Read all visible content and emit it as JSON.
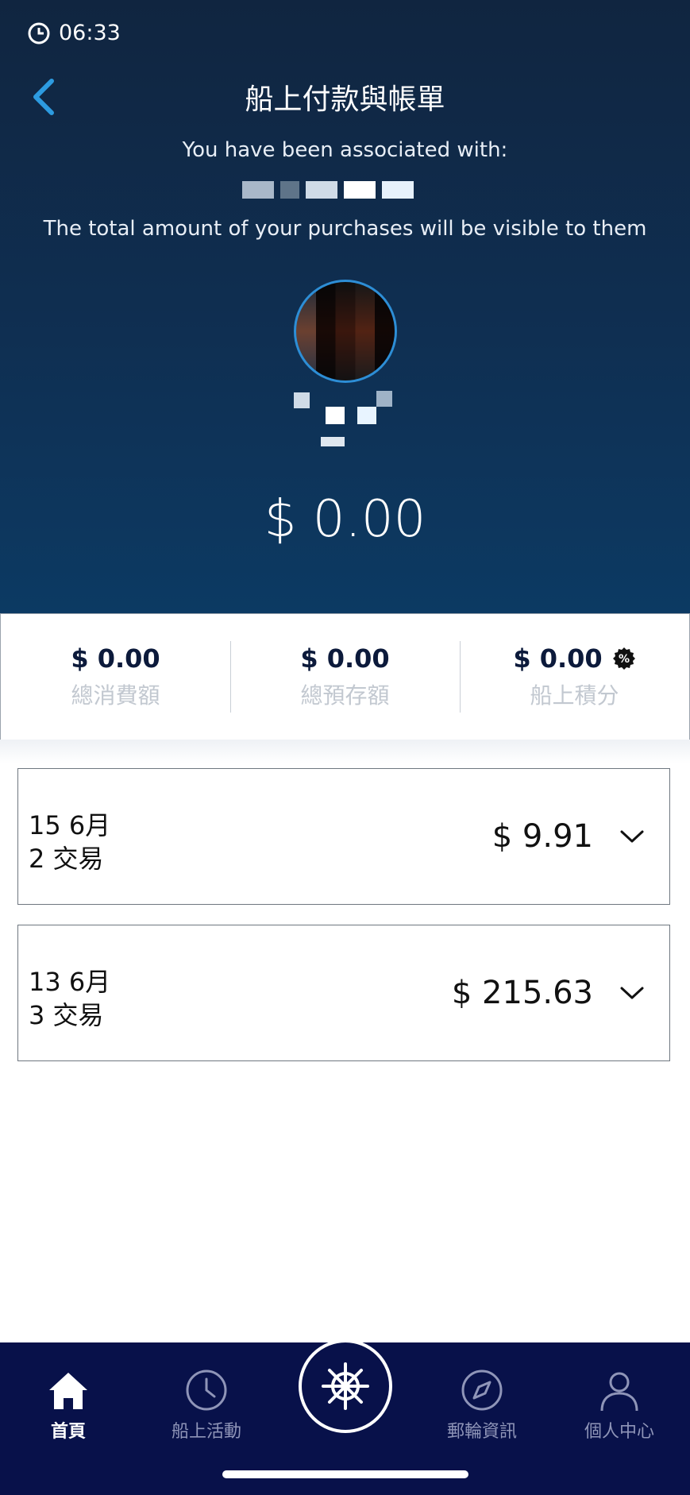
{
  "status": {
    "time": "06:33"
  },
  "header": {
    "title": "船上付款與帳單",
    "associated_line": "You have been associated with:",
    "visible_line": "The total amount of your purchases will be visible to them",
    "total_amount": "$ 0.00"
  },
  "summary": [
    {
      "value": "$ 0.00",
      "label": "總消費額"
    },
    {
      "value": "$ 0.00",
      "label": "總預存額"
    },
    {
      "value": "$ 0.00",
      "label": "船上積分"
    }
  ],
  "days": [
    {
      "date": "15 6月",
      "count": "2 交易",
      "amount": "$ 9.91"
    },
    {
      "date": "13 6月",
      "count": "3 交易",
      "amount": "$ 215.63"
    }
  ],
  "tabbar": {
    "home": "首頁",
    "activities": "船上活動",
    "cruise_info": "郵輪資訊",
    "profile": "個人中心"
  },
  "colors": {
    "header_top": "#102540",
    "header_bottom": "#0c3a63",
    "accent": "#2d8ed6",
    "tabbar": "#08114a",
    "value_text": "#0c1a3b"
  }
}
